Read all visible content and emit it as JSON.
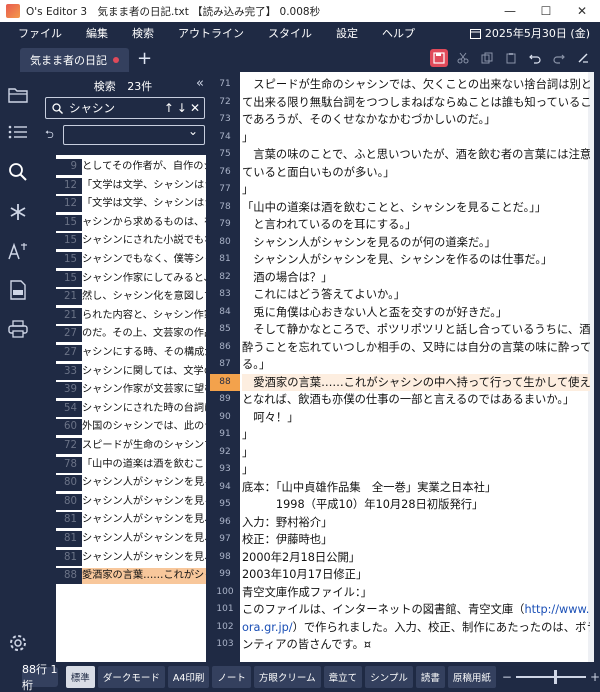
{
  "window": {
    "title": "O's Editor 3　気まま者の日記.txt 【読み込み完了】 0.008秒"
  },
  "menu": {
    "items": [
      "ファイル",
      "編集",
      "検索",
      "アウトライン",
      "スタイル",
      "設定",
      "ヘルプ"
    ],
    "date": "2025年5月30日 (金)"
  },
  "tabs": [
    {
      "label": "気まま者の日記"
    }
  ],
  "rail": {
    "icons": [
      "folder-icon",
      "outline-list-icon",
      "search-icon",
      "asterisk-icon",
      "font-size-icon",
      "pdf-icon",
      "print-icon",
      "settings-icon"
    ]
  },
  "search": {
    "header": "検索",
    "count": "23件",
    "query": "シャシン",
    "results": [
      {
        "line": "9",
        "text": "としてその作者が、自作のシャシン"
      },
      {
        "line": "12",
        "text": "「文学は文学、シャシンはシャシン"
      },
      {
        "line": "12",
        "text": "「文学は文学、シャシンはシャシンと"
      },
      {
        "line": "15",
        "text": "ャシンから求めるものは、在来のシャシン"
      },
      {
        "line": "15",
        "text": "シャシンにされた小説でもなく、僕等"
      },
      {
        "line": "15",
        "text": "シャシンでもなく、僕等シャシン作家に"
      },
      {
        "line": "15",
        "text": "シャシン作家にしてみると、文芸家仲間から"
      },
      {
        "line": "21",
        "text": "然し、シャシン化を意図して書"
      },
      {
        "line": "21",
        "text": "られた内容と、シャシン作家の持"
      },
      {
        "line": "27",
        "text": "のだ。その上、文芸家の作品をシ"
      },
      {
        "line": "27",
        "text": "ャシンにする時、その構成が文芸家にはシャシン"
      },
      {
        "line": "33",
        "text": "シャシンに関しては、文学の場合とシャシン"
      },
      {
        "line": "39",
        "text": "シャシン作家が文芸家に望むものは、シャシン"
      },
      {
        "line": "54",
        "text": "シャシンにされた時の台詞はきっと（シャシン"
      },
      {
        "line": "60",
        "text": "外国のシャシンでは、此の台詞"
      },
      {
        "line": "72",
        "text": "スピードが生命のシャシンでは、"
      },
      {
        "line": "78",
        "text": "「山中の道楽は酒を飲むことと、シャシンを"
      },
      {
        "line": "80",
        "text": "シャシン人がシャシンを見るの"
      },
      {
        "line": "80",
        "text": "シャシン人がシャシンを見るの"
      },
      {
        "line": "81",
        "text": "シャシン人がシャシンを見、シャ"
      },
      {
        "line": "81",
        "text": "シャシン人がシャシンを見、シャ"
      },
      {
        "line": "81",
        "text": "シャシン人がシャシンを見、シャシンを"
      },
      {
        "line": "88",
        "text": "愛酒家の言葉……これがシャシン"
      }
    ]
  },
  "editor": {
    "current_line": "88",
    "lines": [
      {
        "num": "71",
        "text": "　スピードが生命のシャシンでは、欠くことの出来ない捨台詞は別とし"
      },
      {
        "num": "72",
        "text": "て出来る限り無駄台詞をつつしまねばならぬことは誰も知っていること"
      },
      {
        "num": "73",
        "text": "であろうが、そのくせなかなかむづかしいのだ。」"
      },
      {
        "num": "74",
        "text": "」"
      },
      {
        "num": "75",
        "text": "　言葉の味のことで、ふと思いついたが、酒を飲む者の言葉には注意し"
      },
      {
        "num": "76",
        "text": "ていると面白いものが多い。」"
      },
      {
        "num": "77",
        "text": "」"
      },
      {
        "num": "78",
        "text": "「山中の道楽は酒を飲むことと、シャシンを見ることだ。」」"
      },
      {
        "num": "79",
        "text": "　と言われているのを耳にする。」"
      },
      {
        "num": "80",
        "text": "　シャシン人がシャシンを見るのが何の道楽だ。」"
      },
      {
        "num": "81",
        "text": "　シャシン人がシャシンを見、シャシンを作るのは仕事だ。」"
      },
      {
        "num": "82",
        "text": "　酒の場合は？」"
      },
      {
        "num": "83",
        "text": "　これにはどう答えてよいか。」"
      },
      {
        "num": "84",
        "text": "　兎に角僕は心おきない人と盃を交すのが好きだ。」"
      },
      {
        "num": "85",
        "text": "　そして静かなところで、ポツリポツリと話し合っているうちに、酒に"
      },
      {
        "num": "86",
        "text": "酔うことを忘れていつしか相手の、又時には自分の言葉の味に酔ってい"
      },
      {
        "num": "87",
        "text": "る。」"
      },
      {
        "num": "88",
        "text": "　愛酒家の言葉……これがシャシンの中へ持って行って生かして使える"
      },
      {
        "num": "89",
        "text": "となれば、飲酒も亦僕の仕事の一部と言えるのではあるまいか。」"
      },
      {
        "num": "90",
        "text": "　呵々！」"
      },
      {
        "num": "91",
        "text": "」"
      },
      {
        "num": "92",
        "text": "」"
      },
      {
        "num": "93",
        "text": "」"
      },
      {
        "num": "94",
        "text": "底本：「山中貞雄作品集　全一巻」実業之日本社」"
      },
      {
        "num": "95",
        "text": "　　　1998（平成10）年10月28日初版発行」"
      },
      {
        "num": "96",
        "text": "入力：野村裕介」"
      },
      {
        "num": "97",
        "text": "校正：伊藤時也」"
      },
      {
        "num": "98",
        "text": "2000年2月18日公開」"
      },
      {
        "num": "99",
        "text": "2003年10月17日修正」"
      },
      {
        "num": "100",
        "text": "青空文庫作成ファイル：」"
      },
      {
        "num": "101",
        "text": "このファイルは、インターネットの図書館、青空文庫（",
        "link": "http://www.aoz"
      },
      {
        "num": "102",
        "text": "）で作られました。入力、校正、制作にあたったのは、ボラ",
        "link_prefix": "ora.gr.jp/"
      },
      {
        "num": "103",
        "text": "ンティアの皆さんです。¤"
      }
    ]
  },
  "status": {
    "position": "88行 1桁",
    "themes": [
      "標準",
      "ダークモード",
      "A4印刷",
      "ノート",
      "方眼クリーム",
      "章立て",
      "シンプル",
      "読書",
      "原稿用紙"
    ],
    "active_theme": "標準",
    "zoom_level": 0.55
  },
  "colors": {
    "chrome": "#1f2a44",
    "accent": "#e04a5a",
    "current_line": "#f3a24c",
    "selected_result": "#f8c79b"
  }
}
